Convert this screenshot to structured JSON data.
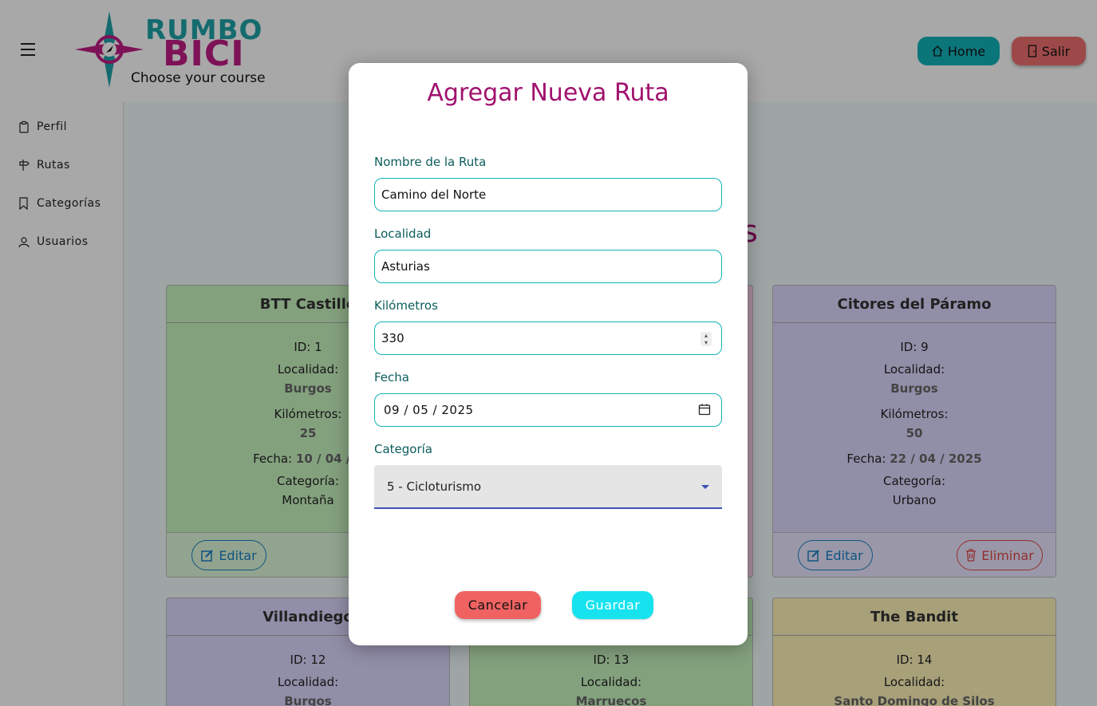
{
  "header": {
    "logo_line1": "RUMBO",
    "logo_line2": "BICI",
    "logo_tagline": "Choose your course",
    "home_label": "Home",
    "logout_label": "Salir"
  },
  "sidebar": {
    "items": [
      {
        "label": "Perfil",
        "icon": "clipboard-icon"
      },
      {
        "label": "Rutas",
        "icon": "signpost-icon"
      },
      {
        "label": "Categorías",
        "icon": "bookmark-icon"
      },
      {
        "label": "Usuarios",
        "icon": "user-icon"
      }
    ]
  },
  "page": {
    "background_title_fragment": "s"
  },
  "labels": {
    "id": "ID:",
    "localidad": "Localidad:",
    "kilometros": "Kilómetros:",
    "fecha": "Fecha:",
    "categoria": "Categoría:",
    "edit": "Editar",
    "delete": "Eliminar"
  },
  "cards": [
    {
      "title": "BTT Castillo",
      "id": "ID: 1",
      "localidad": "Burgos",
      "km": "25",
      "fecha": "10 / 04 / 2",
      "categoria": "Montaña",
      "color": "#c8f5c0"
    },
    {
      "title": "Citores del Páramo",
      "id": "ID: 9",
      "localidad": "Burgos",
      "km": "50",
      "fecha": "22 / 04 / 2025",
      "categoria": "Urbano",
      "color": "#dcd8ff"
    },
    {
      "title": "Villandiego",
      "id": "ID: 12",
      "localidad": "Burgos",
      "color": "#dcd8ff"
    },
    {
      "id": "ID: 13",
      "localidad": "Marruecos",
      "color": "#c8f5c0"
    },
    {
      "title": "The Bandit",
      "id": "ID: 14",
      "localidad": "Santo Domingo de Silos",
      "color": "#fdf3b8"
    }
  ],
  "modal": {
    "title": "Agregar Nueva Ruta",
    "fields": {
      "nombre_label": "Nombre de la Ruta",
      "nombre_value": "Camino del Norte",
      "localidad_label": "Localidad",
      "localidad_value": "Asturias",
      "km_label": "Kilómetros",
      "km_value": "330",
      "fecha_label": "Fecha",
      "fecha_value": "09 / 05 / 2025",
      "categoria_label": "Categoría",
      "categoria_value": "5 - Cicloturismo"
    },
    "cancel_label": "Cancelar",
    "save_label": "Guardar"
  },
  "colors": {
    "accent": "#12b3b9",
    "brand": "#a0126e",
    "danger": "#f06262",
    "save": "#17e3ef"
  }
}
